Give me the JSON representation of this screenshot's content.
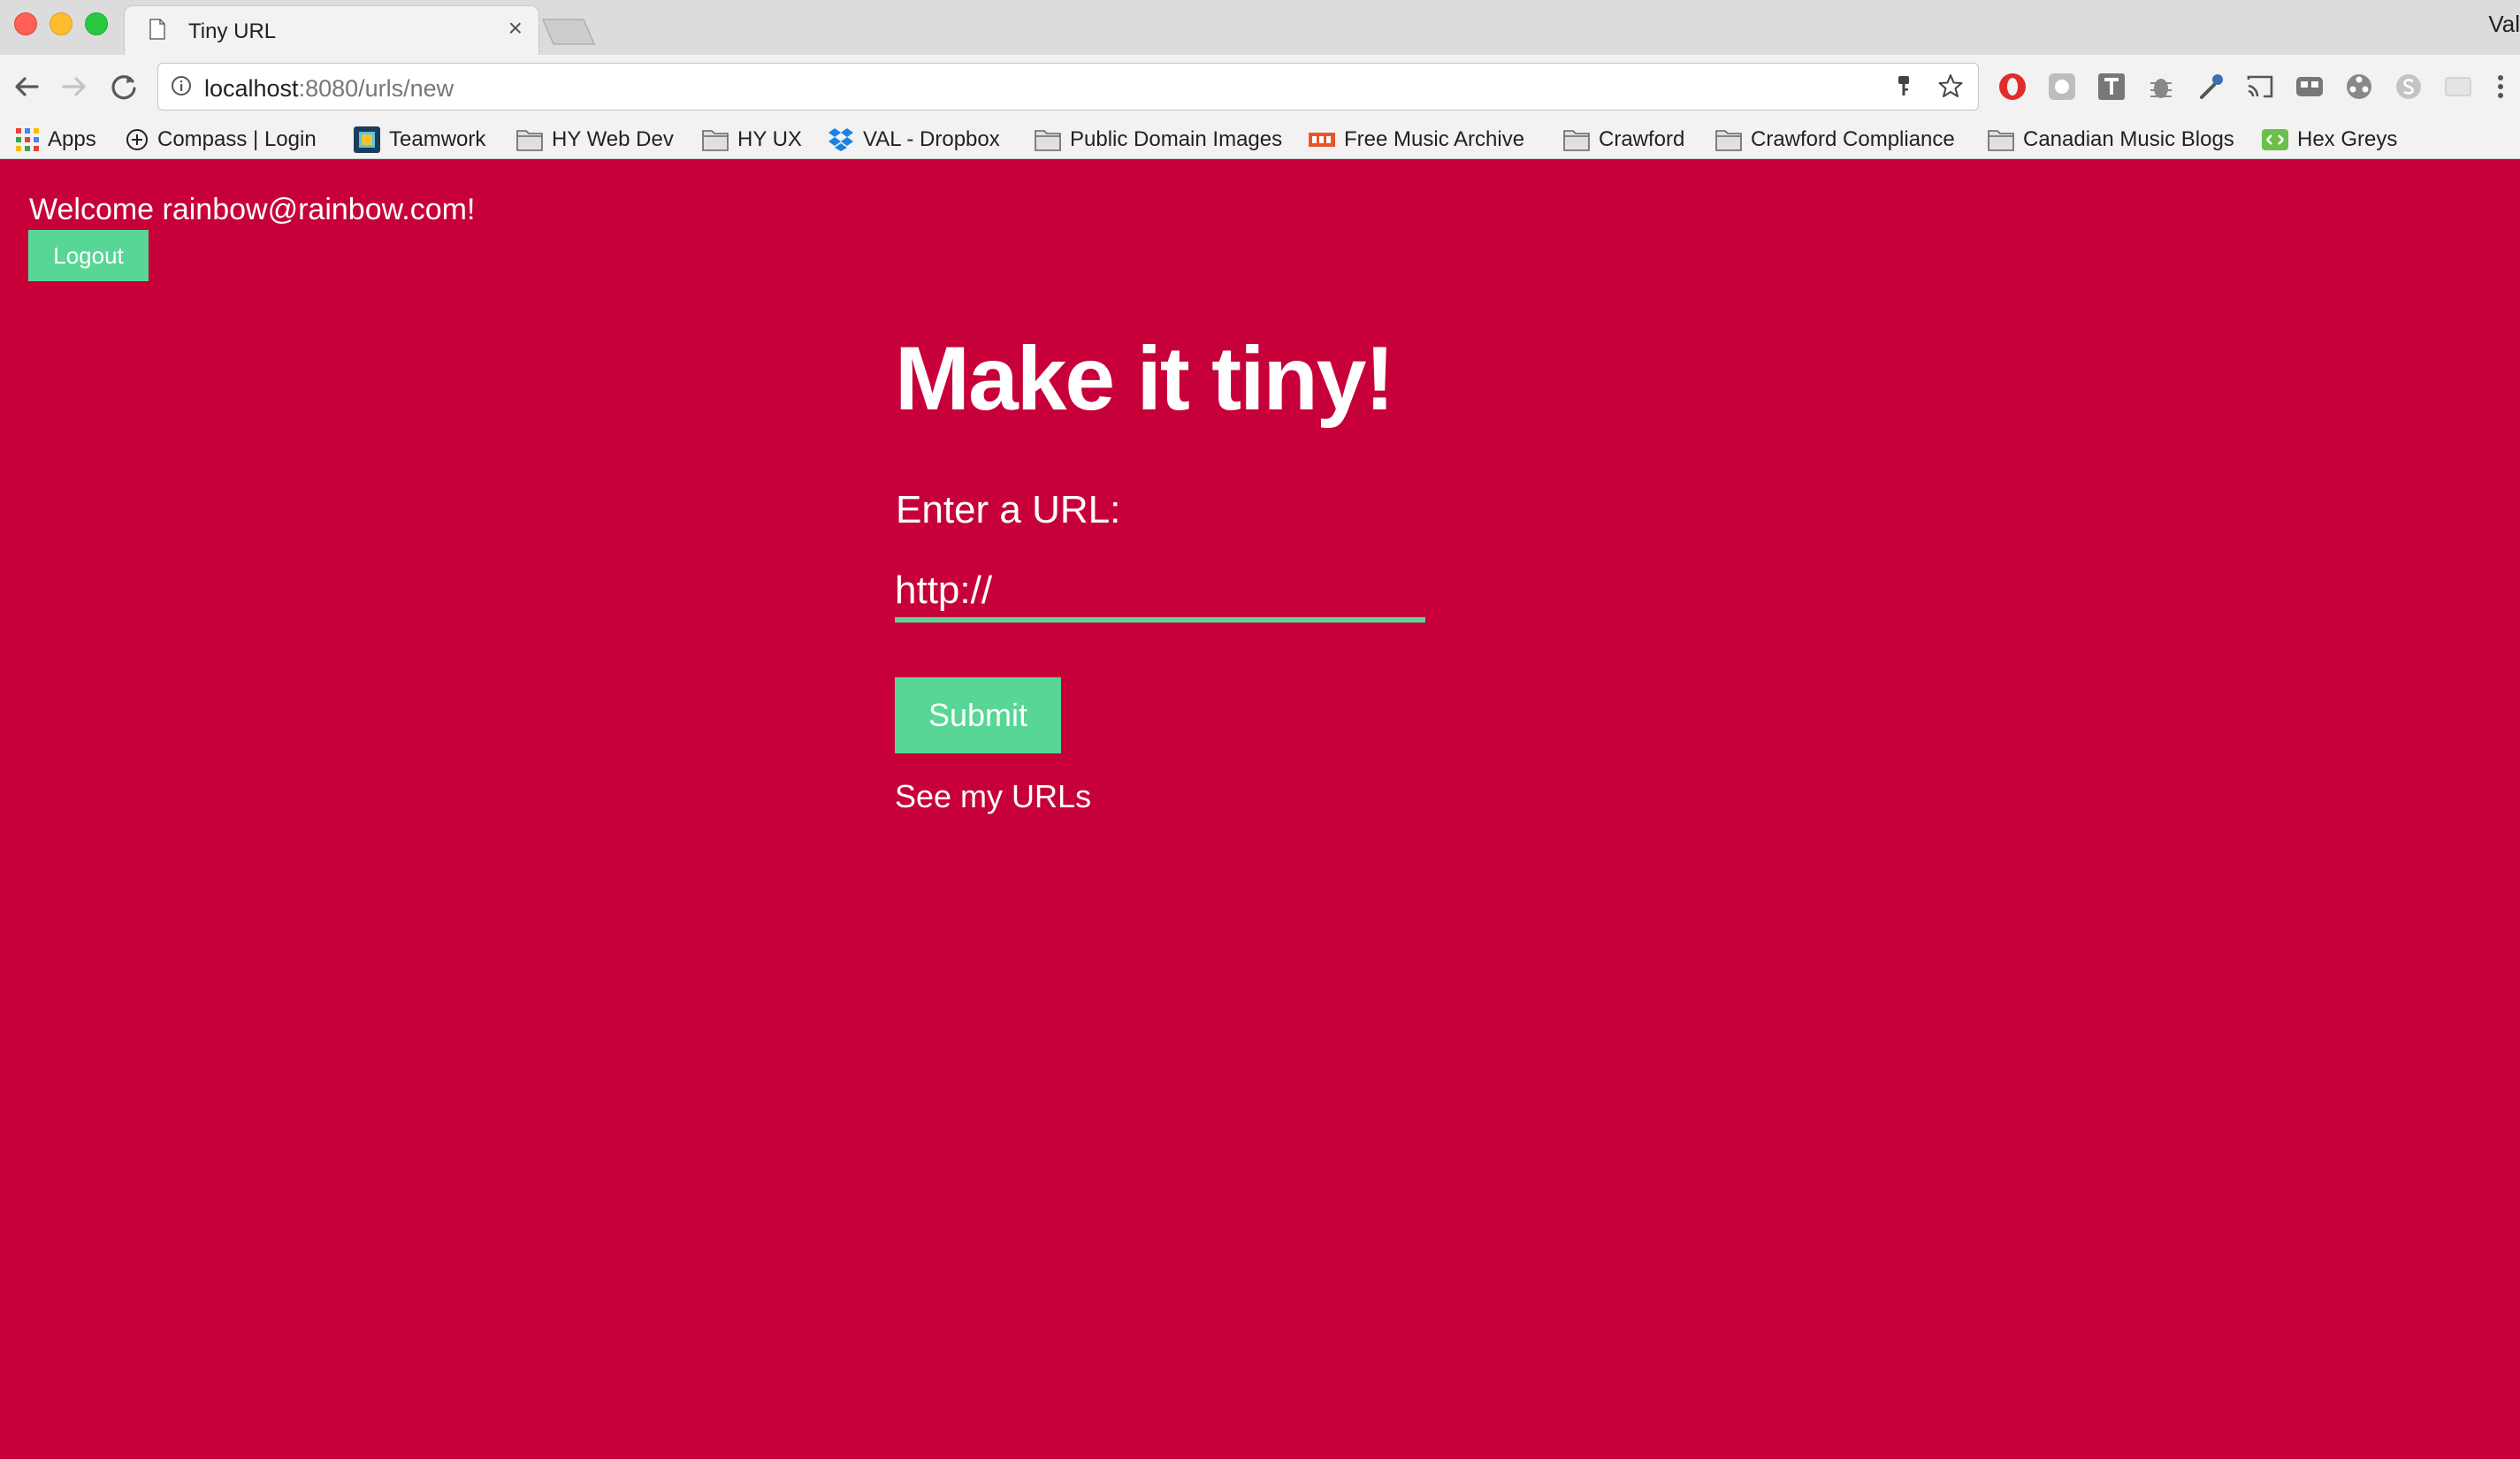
{
  "browser": {
    "tab_title": "Tiny URL",
    "tab_close": "×",
    "profile_name": "Val",
    "url_host": "localhost",
    "url_path": ":8080/urls/new"
  },
  "bookmarks": [
    {
      "label": "Apps",
      "icon": "apps-grid-icon"
    },
    {
      "label": "Compass | Login",
      "icon": "compass-icon"
    },
    {
      "label": "Teamwork",
      "icon": "teamwork-icon"
    },
    {
      "label": "HY Web Dev",
      "icon": "folder-icon"
    },
    {
      "label": "HY UX",
      "icon": "folder-icon"
    },
    {
      "label": "VAL - Dropbox",
      "icon": "dropbox-icon"
    },
    {
      "label": "Public Domain Images",
      "icon": "folder-icon"
    },
    {
      "label": "Free Music Archive",
      "icon": "fma-icon"
    },
    {
      "label": "Crawford",
      "icon": "folder-icon"
    },
    {
      "label": "Crawford Compliance",
      "icon": "folder-icon"
    },
    {
      "label": "Canadian Music Blogs",
      "icon": "folder-icon"
    },
    {
      "label": "Hex Greys",
      "icon": "hex-greys-icon"
    }
  ],
  "page": {
    "welcome": "Welcome rainbow@rainbow.com!",
    "logout_label": "Logout",
    "title": "Make it tiny!",
    "field_label": "Enter a URL:",
    "url_placeholder": "http://",
    "submit_label": "Submit",
    "see_urls_link": "See my URLs"
  },
  "colors": {
    "background": "#c8003a",
    "accent": "#58d695",
    "text": "#ffffff"
  }
}
